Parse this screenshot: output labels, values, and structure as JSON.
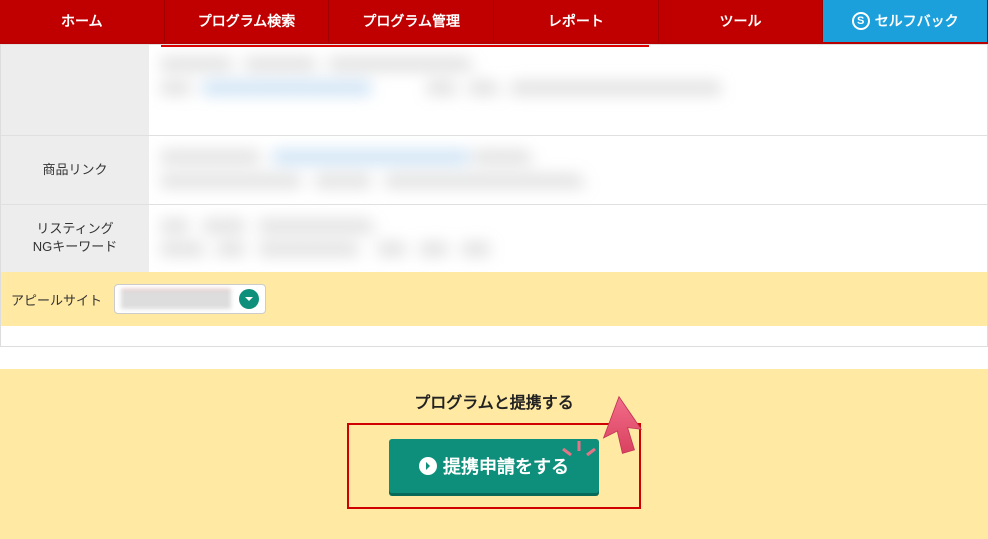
{
  "nav": {
    "items": [
      {
        "label": "ホーム"
      },
      {
        "label": "プログラム検索"
      },
      {
        "label": "プログラム管理"
      },
      {
        "label": "レポート"
      },
      {
        "label": "ツール"
      }
    ],
    "selfback": "セルフバック"
  },
  "rows": {
    "product_link_label": "商品リンク",
    "listing_ng_label_1": "リスティング",
    "listing_ng_label_2": "NGキーワード"
  },
  "appeal": {
    "label": "アピールサイト"
  },
  "cta": {
    "title": "プログラムと提携する",
    "button": "提携申請をする"
  }
}
